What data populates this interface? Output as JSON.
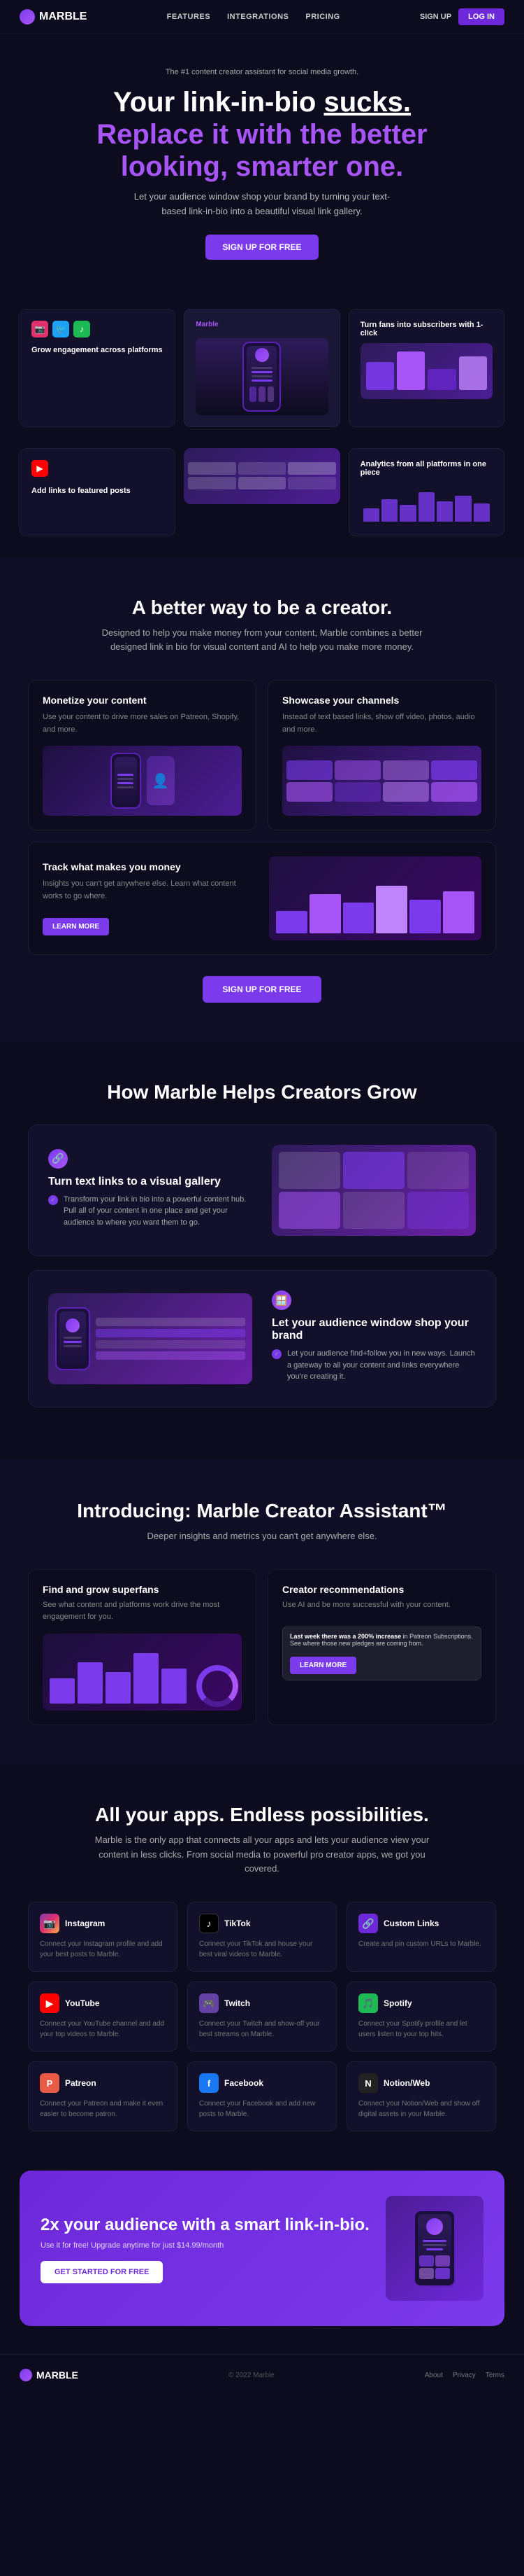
{
  "nav": {
    "logo": "MARBLE",
    "links": [
      "FEATURES",
      "INTEGRATIONS",
      "PRICING"
    ],
    "signin": "SIGN UP",
    "login": "LOG IN"
  },
  "hero": {
    "badge": "The #1 content creator assistant for social media growth.",
    "title_line1": "Your link-in-bio",
    "title_sucks": "sucks.",
    "title_line2": "Replace it with the better",
    "title_line3": "looking, smarter one.",
    "sub": "Let your audience window shop your brand by turning your text-based link-in-bio into a beautiful visual link gallery.",
    "cta": "SIGN UP FOR FREE"
  },
  "feature_cards": [
    {
      "title": "Grow engagement across platforms",
      "icons": [
        "📷",
        "🐦",
        "🎵"
      ]
    },
    {
      "title": "Marble",
      "subtitle": "Phone preview center"
    },
    {
      "title": "Turn fans into subscribers with 1-click"
    }
  ],
  "feature_cards_row2": [
    {
      "title": "Add links to featured posts",
      "icon": "▶"
    },
    {
      "title": "Analytics from all platforms in one piece"
    }
  ],
  "better_section": {
    "title": "A better way to be a creator.",
    "sub": "Designed to help you make money from your content, Marble combines a better designed link in bio for visual content and AI to help you make more money.",
    "features": [
      {
        "title": "Monetize your content",
        "text": "Use your content to drive more sales on Patreon, Shopify, and more."
      },
      {
        "title": "Showcase your channels",
        "text": "Instead of text based links, show off video, photos, audio and more."
      }
    ],
    "feature_full": {
      "title": "Track what makes you money",
      "text": "Insights you can't get anywhere else. Learn what content works to go where.",
      "btn": "LEARN MORE"
    },
    "cta": "SIGN UP FOR FREE"
  },
  "how_section": {
    "title": "How Marble Helps Creators Grow",
    "cards": [
      {
        "icon": "🔗",
        "title": "Turn text links to a visual gallery",
        "checks": [
          "Transform your link in bio into a powerful content hub. Pull all of your content in one place and get your audience to where you want them to go."
        ]
      },
      {
        "icon": "🪟",
        "title": "Let your audience window shop your brand",
        "checks": [
          "Let your audience find+follow you in new ways. Launch a gateway to all your content and links everywhere you're creating it."
        ]
      }
    ]
  },
  "assistant_section": {
    "title": "Introducing: Marble Creator Assistant™",
    "sub": "Deeper insights and metrics you can't get anywhere else.",
    "cards": [
      {
        "title": "Find and grow superfans",
        "text": "See what content and platforms work drive the most engagement for you."
      },
      {
        "title": "Creator recommendations",
        "text": "Use AI and be more successful with your content.",
        "notification": "Last week there was a 200% increase in Patreon Subscriptions. See where those new pledges are coming from."
      }
    ]
  },
  "apps_section": {
    "title": "All your apps. Endless possibilities.",
    "sub": "Marble is the only app that connects all your apps and lets your audience view your content in less clicks. From social media to powerful pro creator apps, we got you covered.",
    "apps": [
      {
        "name": "Instagram",
        "icon": "📷",
        "icon_class": "ai-ig",
        "desc": "Connect your Instagram profile and add your best posts to Marble."
      },
      {
        "name": "TikTok",
        "icon": "🎵",
        "icon_class": "ai-tt",
        "desc": "Connect your TikTok and house your best viral videos to Marble."
      },
      {
        "name": "Custom Links",
        "icon": "🔗",
        "icon_class": "ai-cl",
        "desc": "Create and pin custom URLs to Marble."
      },
      {
        "name": "YouTube",
        "icon": "▶",
        "icon_class": "ai-yt",
        "desc": "Connect your YouTube channel and add your top videos to Marble."
      },
      {
        "name": "Twitch",
        "icon": "🎮",
        "icon_class": "ai-tw",
        "desc": "Connect your Twitch and show-off your best streams on Marble."
      },
      {
        "name": "Spotify",
        "icon": "🎵",
        "icon_class": "ai-sp",
        "desc": "Connect your Spotify profile and let users listen to your top hits."
      },
      {
        "name": "Patreon",
        "icon": "🅿",
        "icon_class": "ai-pa",
        "desc": "Connect your Patreon and make it even easier to become patron."
      },
      {
        "name": "Facebook",
        "icon": "f",
        "icon_class": "ai-fb",
        "desc": "Connect your Facebook and add new posts to Marble."
      },
      {
        "name": "Notion/Web",
        "icon": "N",
        "icon_class": "ai-nb",
        "desc": "Connect your Notion/Web and show off digital assets in your Marble."
      }
    ]
  },
  "cta_banner": {
    "title": "2x your audience with a smart link-in-bio.",
    "sub": "Use it for free! Upgrade anytime for just $14.99/month",
    "btn": "GET STARTED FOR FREE"
  },
  "footer": {
    "logo": "MARBLE",
    "copy": "© 2022 Marble",
    "links": [
      "About",
      "Privacy",
      "Terms"
    ]
  }
}
